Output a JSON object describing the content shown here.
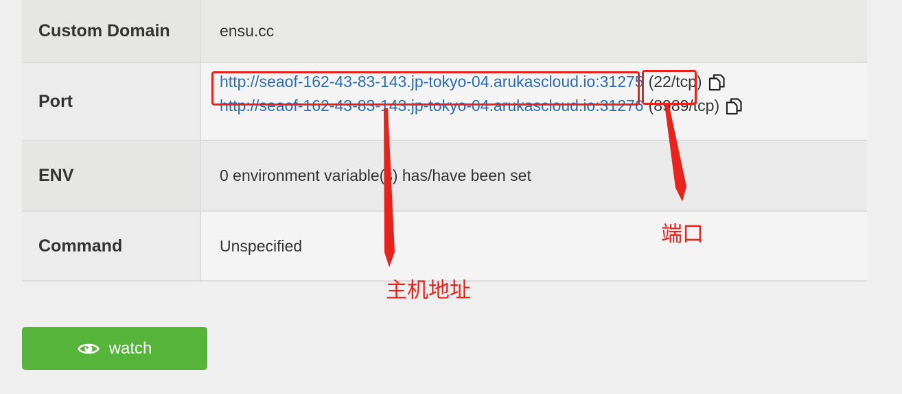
{
  "rows": {
    "domain": {
      "label": "Custom Domain",
      "value": "ensu.cc"
    },
    "port": {
      "label": "Port",
      "entries": [
        {
          "host": "http://seaof-162-43-83-143.jp-tokyo-04.arukascloud.io:",
          "port": "31275",
          "proto": "(22/tcp)",
          "icon": "copy-icon"
        },
        {
          "host": "http://seaof-162-43-83-143.jp-tokyo-04.arukascloud.io:",
          "port": "31276",
          "proto": "(8989/tcp)",
          "icon": "copy-icon"
        }
      ]
    },
    "env": {
      "label": "ENV",
      "value": "0 environment variable(s) has/have been set"
    },
    "command": {
      "label": "Command",
      "value": "Unspecified"
    }
  },
  "watch_button": {
    "label": "watch",
    "icon": "eye-icon"
  },
  "annotations": {
    "port_label": "端口",
    "host_label": "主机地址",
    "color": "#e8231e"
  },
  "colors": {
    "link": "#2a6db5",
    "button": "#56b43a"
  }
}
